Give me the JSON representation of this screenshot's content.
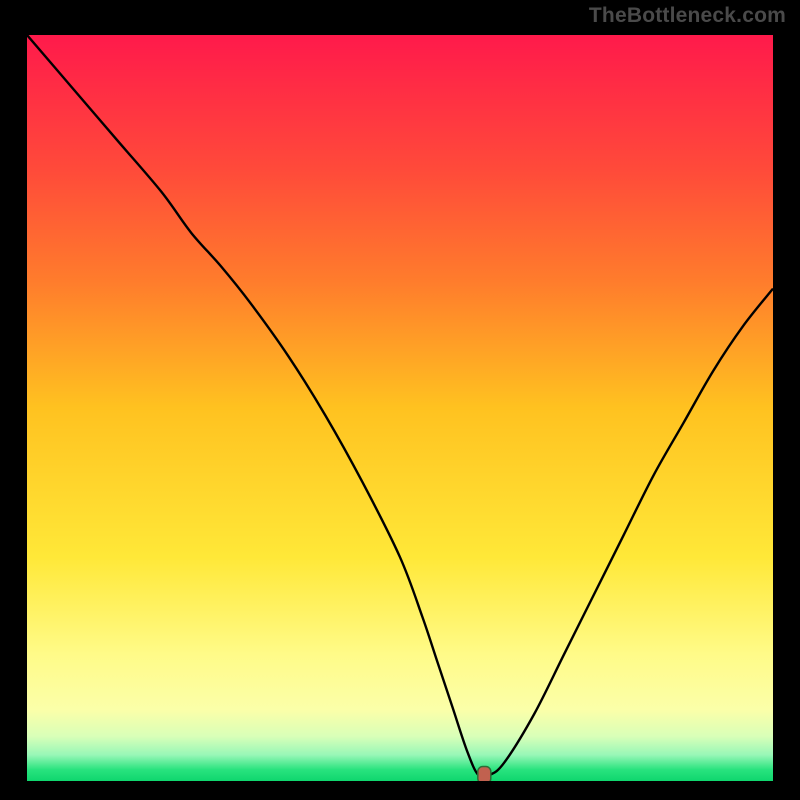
{
  "branding": {
    "text": "TheBottleneck.com"
  },
  "colors": {
    "frame": "#000000",
    "branding_text": "#4a4a4a",
    "curve_stroke": "#000000",
    "marker_fill": "#c1614f",
    "marker_stroke": "#2e6d37",
    "gradient_stops": [
      {
        "offset": 0.0,
        "color": "#ff1a4b"
      },
      {
        "offset": 0.18,
        "color": "#ff4a3a"
      },
      {
        "offset": 0.33,
        "color": "#ff7c2c"
      },
      {
        "offset": 0.5,
        "color": "#ffc220"
      },
      {
        "offset": 0.7,
        "color": "#ffe838"
      },
      {
        "offset": 0.83,
        "color": "#fffb88"
      },
      {
        "offset": 0.905,
        "color": "#fbffa9"
      },
      {
        "offset": 0.94,
        "color": "#d9ffb8"
      },
      {
        "offset": 0.965,
        "color": "#98f7b7"
      },
      {
        "offset": 0.985,
        "color": "#28e37e"
      },
      {
        "offset": 1.0,
        "color": "#0fd66e"
      }
    ]
  },
  "chart_data": {
    "type": "line",
    "title": "",
    "xlabel": "",
    "ylabel": "",
    "xlim": [
      0,
      100
    ],
    "ylim": [
      0,
      100
    ],
    "series": [
      {
        "name": "bottleneck-curve",
        "x": [
          0,
          6,
          12,
          18,
          22,
          26,
          30,
          35,
          40,
          45,
          50,
          53,
          55,
          57,
          59,
          60.5,
          62,
          64,
          68,
          72,
          76,
          80,
          84,
          88,
          92,
          96,
          100
        ],
        "y": [
          100,
          93,
          86,
          79,
          73.5,
          69,
          64,
          57,
          49,
          40,
          30,
          22,
          16,
          10,
          4,
          0.8,
          0.8,
          2.5,
          9,
          17,
          25,
          33,
          41,
          48,
          55,
          61,
          66
        ]
      }
    ],
    "marker": {
      "x": 61.3,
      "y": 0.8,
      "label": "optimal-point"
    }
  }
}
